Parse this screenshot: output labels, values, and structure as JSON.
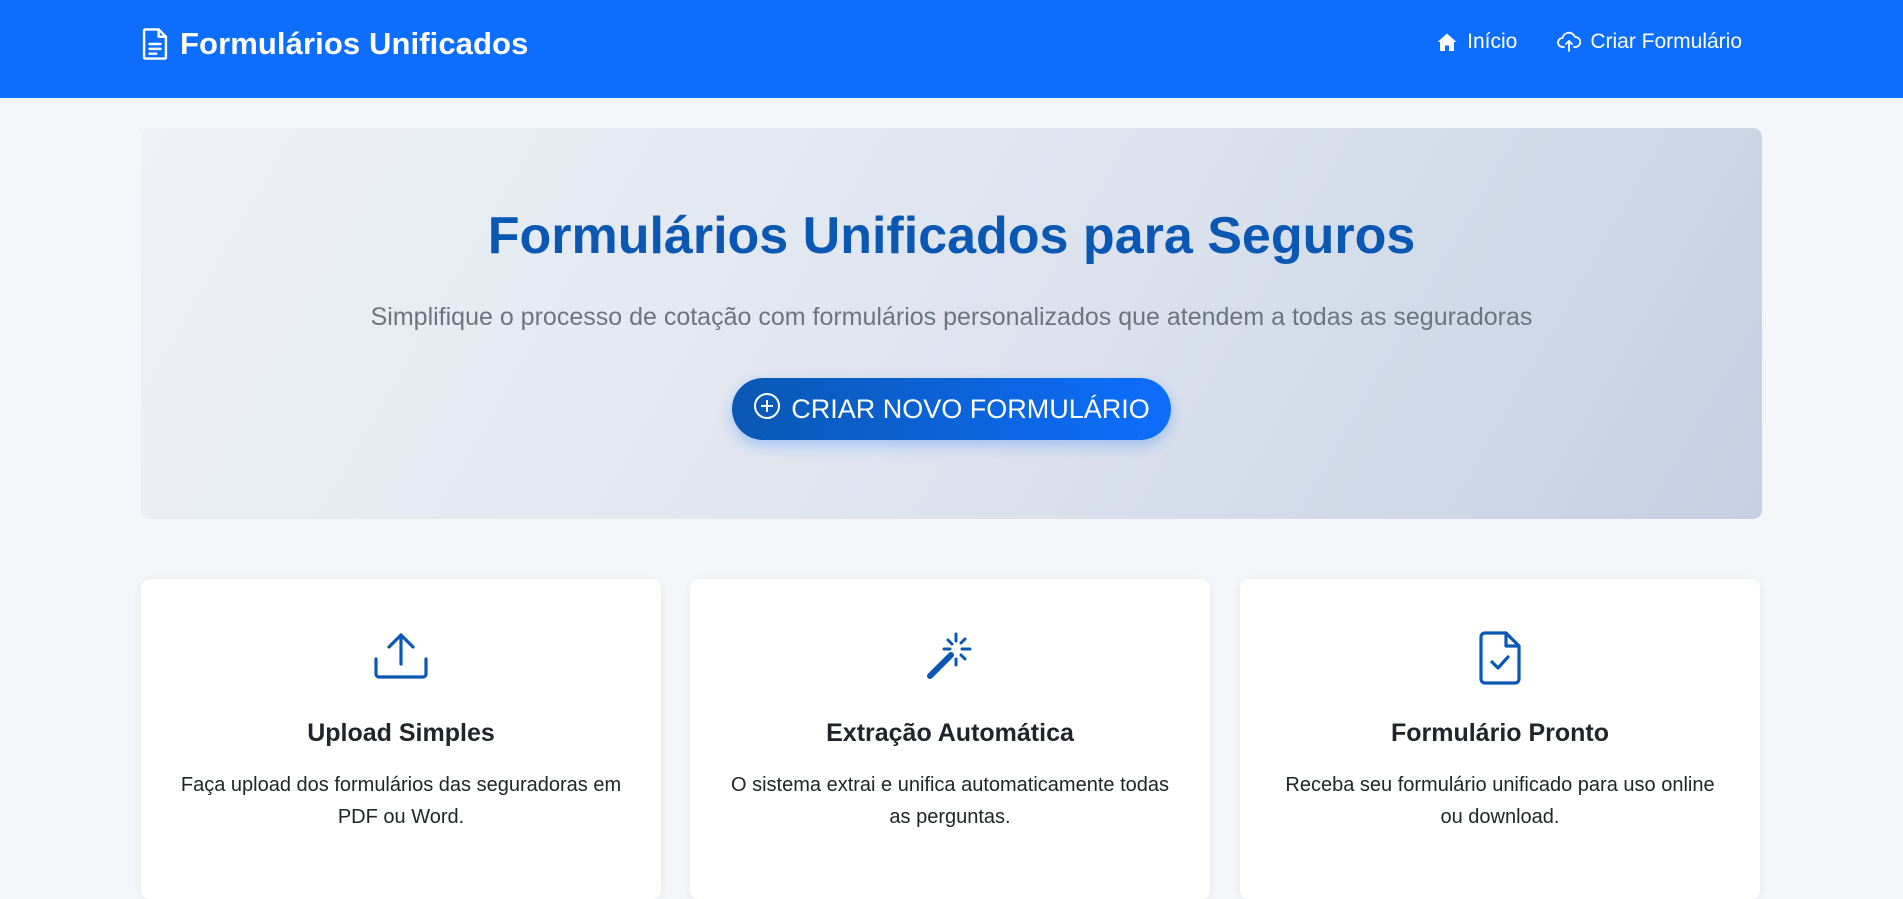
{
  "navbar": {
    "brand": "Formulários Unificados",
    "brand_icon": "document-icon",
    "links": [
      {
        "label": "Início",
        "icon": "home-icon"
      },
      {
        "label": "Criar Formulário",
        "icon": "cloud-upload-icon"
      }
    ],
    "color": "#0d6efd"
  },
  "hero": {
    "title": "Formulários Unificados para Seguros",
    "subtitle": "Simplifique o processo de cotação com formulários personalizados que atendem a todas as seguradoras",
    "button_label": "CRIAR NOVO FORMULÁRIO",
    "button_icon": "plus-circle-icon",
    "title_color": "#0a58b3"
  },
  "features": [
    {
      "icon": "upload-icon",
      "title": "Upload Simples",
      "text": "Faça upload dos formulários das seguradoras em PDF ou Word."
    },
    {
      "icon": "magic-wand-icon",
      "title": "Extração Automática",
      "text": "O sistema extrai e unifica automaticamente todas as perguntas."
    },
    {
      "icon": "file-check-icon",
      "title": "Formulário Pronto",
      "text": "Receba seu formulário unificado para uso online ou download."
    }
  ]
}
